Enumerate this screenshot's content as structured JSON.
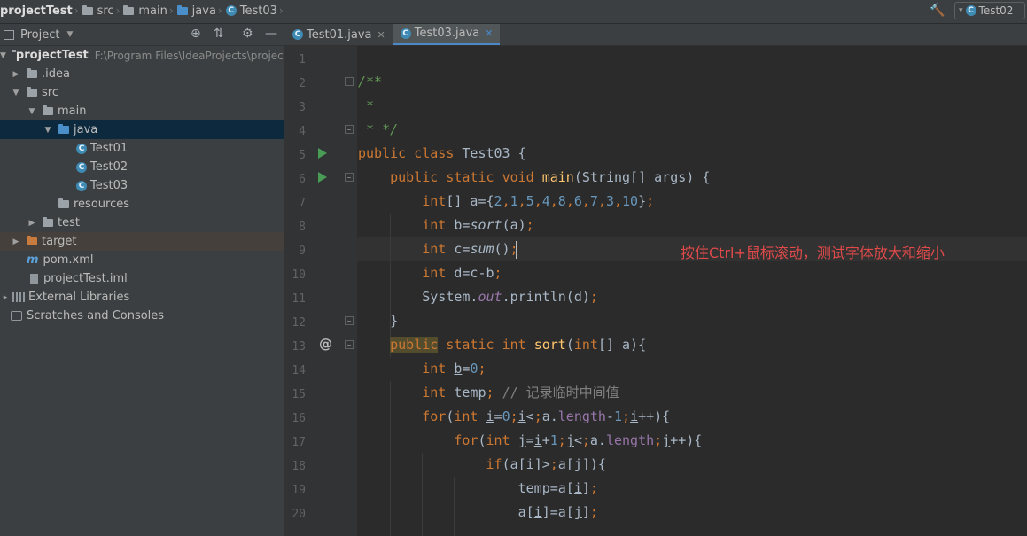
{
  "breadcrumb": {
    "project": "projectTest",
    "items": [
      "src",
      "main",
      "java",
      "Test03"
    ]
  },
  "run_config": {
    "label": "Test02"
  },
  "project_panel": {
    "title": "Project",
    "tree": [
      {
        "label": "projectTest",
        "note": "F:\\Program Files\\IdeaProjects\\projectTest",
        "kind": "project",
        "depth": 0,
        "arrow": "down"
      },
      {
        "label": ".idea",
        "kind": "folder",
        "depth": 1,
        "arrow": "right"
      },
      {
        "label": "src",
        "kind": "folder",
        "depth": 1,
        "arrow": "down"
      },
      {
        "label": "main",
        "kind": "folder",
        "depth": 2,
        "arrow": "down"
      },
      {
        "label": "java",
        "kind": "folder-blue",
        "depth": 3,
        "arrow": "down",
        "selected": true
      },
      {
        "label": "Test01",
        "kind": "class",
        "depth": 4
      },
      {
        "label": "Test02",
        "kind": "class",
        "depth": 4
      },
      {
        "label": "Test03",
        "kind": "class",
        "depth": 4
      },
      {
        "label": "resources",
        "kind": "folder-res",
        "depth": 3
      },
      {
        "label": "test",
        "kind": "folder",
        "depth": 2,
        "arrow": "right"
      },
      {
        "label": "target",
        "kind": "folder-orange",
        "depth": 1,
        "arrow": "right",
        "excluded": true
      },
      {
        "label": "pom.xml",
        "kind": "maven",
        "depth": 1
      },
      {
        "label": "projectTest.iml",
        "kind": "file",
        "depth": 1
      },
      {
        "label": "External Libraries",
        "kind": "library",
        "depth": 0,
        "arrow": "right"
      },
      {
        "label": "Scratches and Consoles",
        "kind": "scratch",
        "depth": 0
      }
    ]
  },
  "tabs": [
    {
      "label": "Test01.java",
      "active": false
    },
    {
      "label": "Test03.java",
      "active": true
    }
  ],
  "editor": {
    "line_numbers": [
      "1",
      "2",
      "3",
      "4",
      "5",
      "6",
      "7",
      "8",
      "9",
      "10",
      "11",
      "12",
      "13",
      "14",
      "15",
      "16",
      "17",
      "18",
      "19",
      "20"
    ],
    "lines": [
      "",
      "/**",
      " *",
      " * */",
      "public class Test03 {",
      "    public static void main(String[] args) {",
      "        int[] a={2,1,5,4,8,6,7,3,10};",
      "        int b=sort(a);",
      "        int c=sum();",
      "        int d=c-b;",
      "        System.out.println(d);",
      "    }",
      "    public static int sort(int[] a){",
      "        int b=0;",
      "        int temp; // 记录临时中间值",
      "        for(int i=0;i<a.length-1;i++){",
      "            for(int j=i+1;j<a.length;j++){",
      "                if(a[i]>a[j]){",
      "                    temp=a[i];",
      "                    a[i]=a[j];"
    ]
  },
  "annotation": "按住Ctrl+鼠标滚动，测试字体放大和缩小"
}
